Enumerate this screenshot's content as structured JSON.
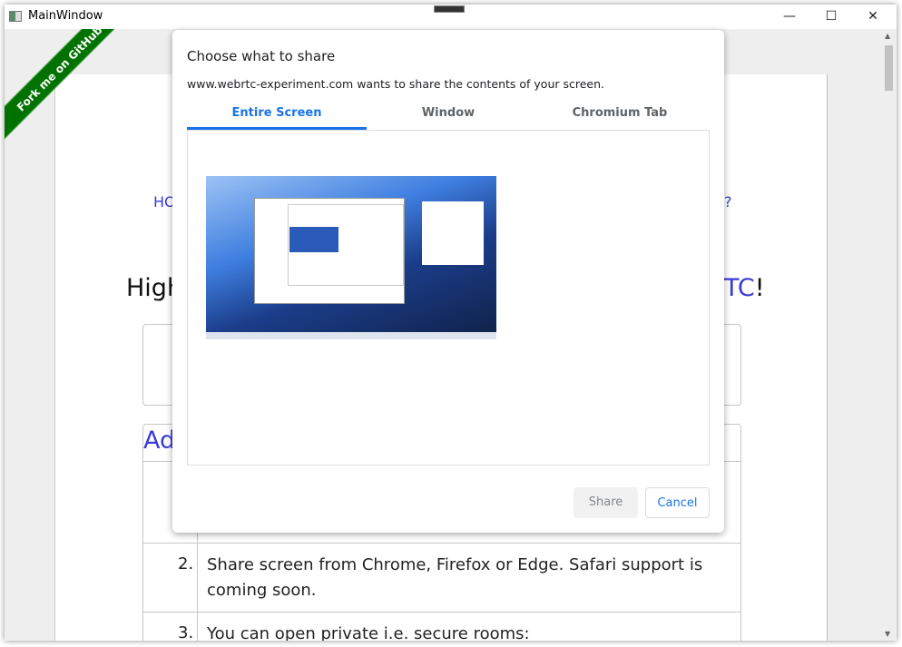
{
  "window": {
    "title": "MainWindow",
    "minimize": "—",
    "maximize": "☐",
    "close": "✕"
  },
  "page": {
    "ribbon": "Fork me on GitHub",
    "nav_left": "HO",
    "nav_right": "?",
    "heading_left": "High",
    "heading_right_blue": "TC",
    "heading_right_end": "!",
    "section_title": "Ad",
    "items": [
      {
        "num": "2.",
        "text": "Share screen from Chrome, Firefox or Edge. Safari support is coming soon."
      },
      {
        "num": "3.",
        "text": "You can open private i.e. secure rooms:"
      }
    ]
  },
  "dialog": {
    "title": "Choose what to share",
    "subtitle": "www.webrtc-experiment.com wants to share the contents of your screen.",
    "tabs": [
      {
        "label": "Entire Screen",
        "active": true
      },
      {
        "label": "Window",
        "active": false
      },
      {
        "label": "Chromium Tab",
        "active": false
      }
    ],
    "share_label": "Share",
    "cancel_label": "Cancel"
  },
  "colors": {
    "accent": "#1a73e8",
    "link": "#3b3bd6",
    "ribbon": "#007200"
  }
}
